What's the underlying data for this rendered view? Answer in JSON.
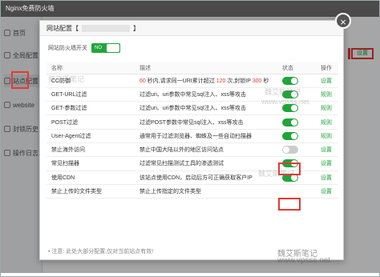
{
  "app": {
    "title": "Nginx免费防火墙"
  },
  "sidebar": {
    "items": [
      {
        "label": "首页",
        "icon": "home-icon"
      },
      {
        "label": "全局配置",
        "icon": "gear-icon"
      },
      {
        "label": "站点配置",
        "icon": "globe-icon"
      },
      {
        "label": "website",
        "icon": "shield-icon"
      },
      {
        "label": "封锁历史",
        "icon": "lock-icon"
      },
      {
        "label": "操作日志",
        "icon": "log-icon"
      }
    ]
  },
  "background": {
    "setting_link": "设置"
  },
  "modal": {
    "title": "网站配置【",
    "title_suffix": "】",
    "firewall_label": "网站防火墙开关",
    "firewall_state": "NO",
    "close_glyph": "×",
    "columns": {
      "name": "名称",
      "desc": "描述",
      "state": "状态",
      "op": "操作"
    },
    "rows": [
      {
        "name": "CC防御",
        "desc_pre": "",
        "desc_num1": "60",
        "desc_mid": " 秒内,请求同一URI累计超过 ",
        "desc_num2": "120",
        "desc_mid2": " 次,封锁IP ",
        "desc_num3": "300",
        "desc_post": " 秒",
        "on": true,
        "op": "设置"
      },
      {
        "name": "GET-URL过滤",
        "desc": "过滤uri、uri参数中常见sql注入、xss等攻击",
        "on": true,
        "op": "规则"
      },
      {
        "name": "GET-参数过滤",
        "desc": "过滤uri、uri参数中常见sql注入、xss等攻击",
        "on": true,
        "op": "规则"
      },
      {
        "name": "POST过滤",
        "desc": "过滤POST参数中常见sql注入、xss等攻击",
        "on": true,
        "op": "规则"
      },
      {
        "name": "User-Agent过滤",
        "desc": "通常用于过滤浏览器、蜘蛛及一些自动扫描器",
        "on": true,
        "op": "规则"
      },
      {
        "name": "禁止海外访问",
        "desc": "禁止中国大陆以外的地区访问站点",
        "on": false,
        "op": "设置"
      },
      {
        "name": "常见扫描器",
        "desc": "过滤常见扫描测试工具的渗透测试",
        "on": true,
        "op": "设置"
      },
      {
        "name": "使用CDN",
        "desc": "该站点使用CDN，启动后方可正确获取客户IP",
        "on": true,
        "op": "设置"
      },
      {
        "name": "禁止上传的文件类型",
        "desc": "禁止上传指定的文件类型",
        "on": null,
        "op": "设置"
      }
    ],
    "footer": "• 注意: 此处大部分配置,仅对当前站点有效!"
  },
  "watermarks": [
    "魏艾斯笔记",
    "www.vpsss.net"
  ]
}
